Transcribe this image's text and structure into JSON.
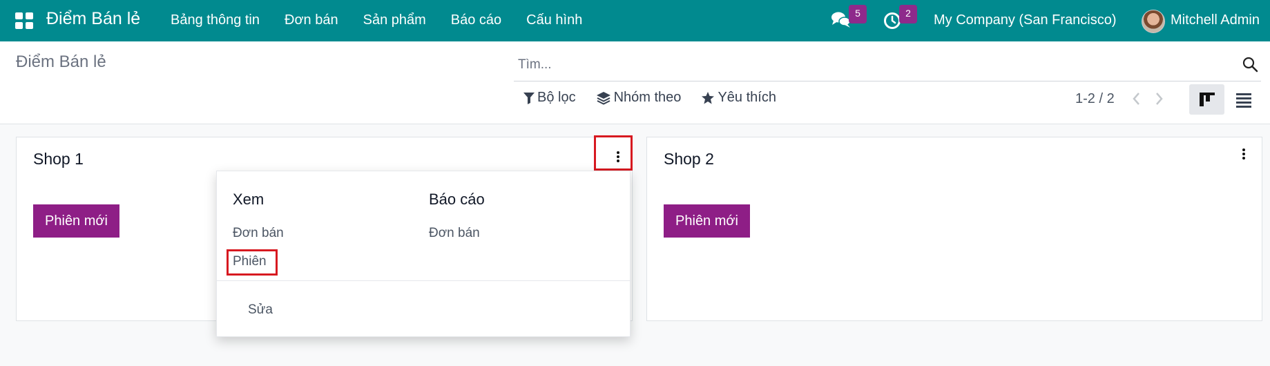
{
  "navbar": {
    "brand": "Điểm Bán lẻ",
    "menu": [
      "Bảng thông tin",
      "Đơn bán",
      "Sản phẩm",
      "Báo cáo",
      "Cấu hình"
    ],
    "messages_badge": "5",
    "activities_badge": "2",
    "company": "My Company (San Francisco)",
    "user": "Mitchell Admin",
    "bg_color": "#018a8f"
  },
  "control_panel": {
    "breadcrumb": "Điểm Bán lẻ",
    "search_placeholder": "Tìm...",
    "filters_label": "Bộ lọc",
    "group_by_label": "Nhóm theo",
    "favorites_label": "Yêu thích",
    "pager": "1-2 / 2"
  },
  "cards": [
    {
      "title": "Shop 1",
      "new_session_label": "Phiên mới"
    },
    {
      "title": "Shop 2",
      "new_session_label": "Phiên mới"
    }
  ],
  "dropdown": {
    "view_title": "Xem",
    "view_items": [
      "Đơn bán",
      "Phiên"
    ],
    "report_title": "Báo cáo",
    "report_items": [
      "Đơn bán"
    ],
    "edit_label": "Sửa"
  },
  "colors": {
    "primary_button": "#8e1e86",
    "badge": "#8e2a8b",
    "highlight": "#d71920"
  }
}
